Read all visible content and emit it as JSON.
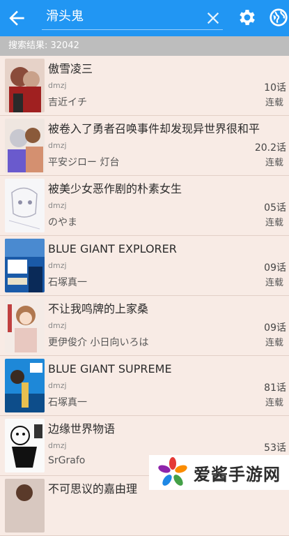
{
  "search": {
    "query": "滑头鬼",
    "result_label": "搜索结果: 32042"
  },
  "results": [
    {
      "title": "傲雪凌三",
      "source": "dmzj",
      "author": "吉近イチ",
      "chapters": "10话",
      "status": "连载"
    },
    {
      "title": "被卷入了勇者召唤事件却发现异世界很和平",
      "source": "dmzj",
      "author": "平安ジロー 灯台",
      "chapters": "20.2话",
      "status": "连载"
    },
    {
      "title": "被美少女恶作剧的朴素女生",
      "source": "dmzj",
      "author": "のやま",
      "chapters": "05话",
      "status": "连载"
    },
    {
      "title": "BLUE GIANT EXPLORER",
      "source": "dmzj",
      "author": "石塚真一",
      "chapters": "09话",
      "status": "连载"
    },
    {
      "title": "不让我鸣牌的上家桑",
      "source": "dmzj",
      "author": "更伊俊介 小日向いろは",
      "chapters": "09话",
      "status": "连载"
    },
    {
      "title": "BLUE GIANT SUPREME",
      "source": "dmzj",
      "author": "石塚真一",
      "chapters": "81话",
      "status": "连载"
    },
    {
      "title": "边缘世界物语",
      "source": "dmzj",
      "author": "SrGrafo",
      "chapters": "53话",
      "status": ""
    },
    {
      "title": "不可思议的嘉由理",
      "source": "",
      "author": "",
      "chapters": "",
      "status": ""
    }
  ],
  "watermark": {
    "brand": "爱酱手游网"
  },
  "colors": {
    "appbar": "#2196f3",
    "countbar": "#bdbdbd",
    "background": "#f4e4dc"
  }
}
